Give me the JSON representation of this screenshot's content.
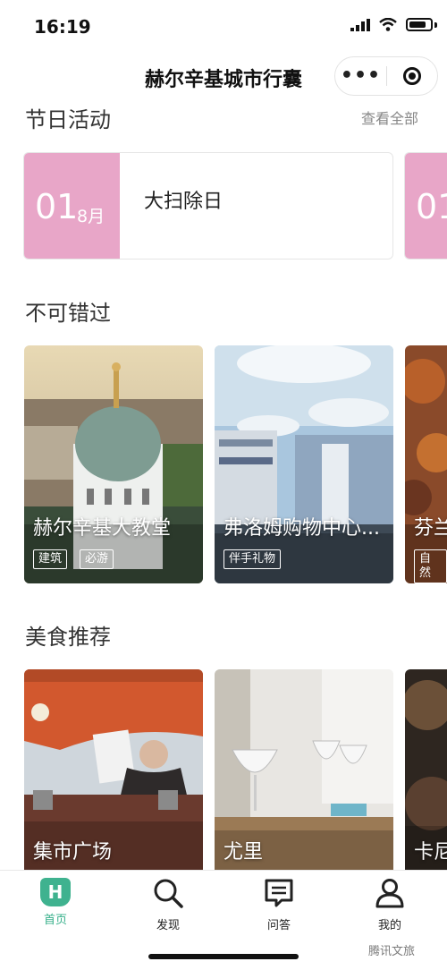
{
  "status": {
    "time": "16:19"
  },
  "nav": {
    "title": "赫尔辛基城市行囊",
    "more_icon": "more-dots-icon",
    "close_icon": "target-circle-icon"
  },
  "festivals": {
    "title": "节日活动",
    "see_all": "查看全部",
    "items": [
      {
        "day": "01",
        "month": "8月",
        "name": "大扫除日",
        "color": "#e8a6c8"
      },
      {
        "day": "01",
        "month": "",
        "name": "",
        "color": "#e8a6c8"
      }
    ]
  },
  "must_see": {
    "title": "不可错过",
    "items": [
      {
        "name": "赫尔辛基大教堂",
        "tags": [
          "建筑",
          "必游"
        ]
      },
      {
        "name": "弗洛姆购物中心...",
        "tags": [
          "伴手礼物"
        ]
      },
      {
        "name": "芬兰",
        "tags": [
          "自然"
        ]
      }
    ]
  },
  "food": {
    "title": "美食推荐",
    "items": [
      {
        "name": "集市广场"
      },
      {
        "name": "尤里"
      },
      {
        "name": "卡尼"
      }
    ]
  },
  "tabbar": {
    "items": [
      {
        "label": "首页",
        "icon": "home-h-icon",
        "active": true
      },
      {
        "label": "发现",
        "icon": "search-icon",
        "active": false
      },
      {
        "label": "问答",
        "icon": "chat-icon",
        "active": false
      },
      {
        "label": "我的",
        "icon": "user-icon",
        "active": false
      }
    ],
    "home_glyph": "H"
  },
  "watermark": "腾讯文旅",
  "colors": {
    "accent": "#3fb28f",
    "date_pink": "#e8a6c8"
  }
}
